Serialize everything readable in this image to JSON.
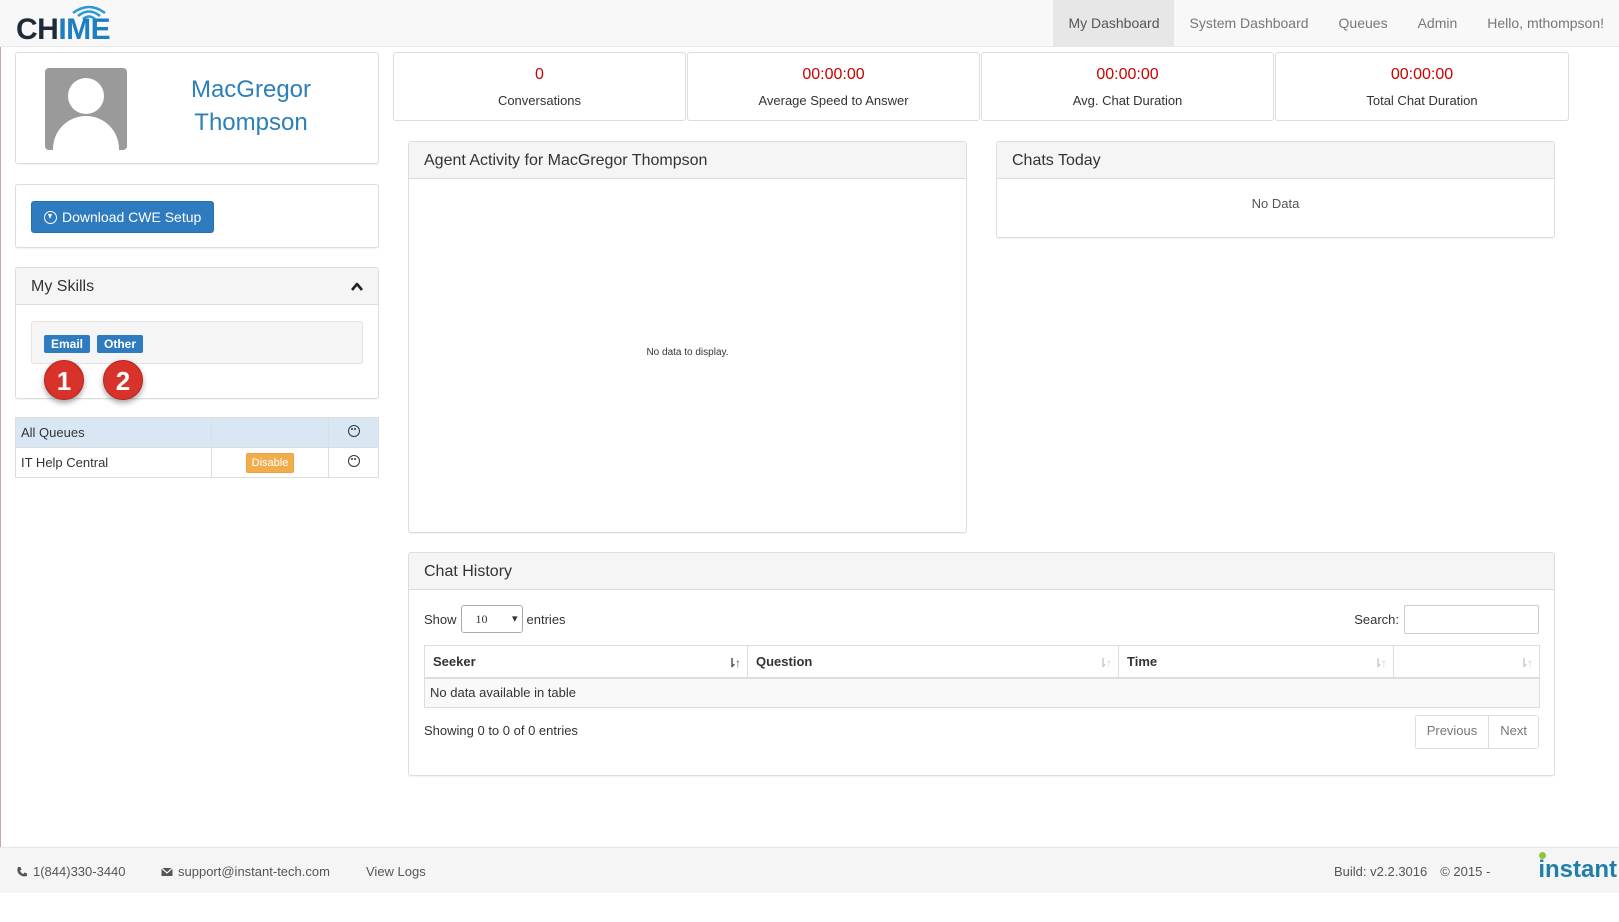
{
  "app": {
    "logo_text_left": "CH",
    "logo_text_right": "IME",
    "colors": {
      "primary": "#2e7bbf",
      "stat_value": "#cc0000",
      "warning": "#f0ad4e",
      "marker": "#d8322a",
      "brand": "#1f7fa8"
    }
  },
  "nav": {
    "items": [
      "My Dashboard",
      "System Dashboard",
      "Queues",
      "Admin",
      "Hello, mthompson!"
    ],
    "active": "My Dashboard"
  },
  "profile": {
    "first_name": "MacGregor",
    "last_name": "Thompson",
    "avatar_icon": "user-silhouette-icon"
  },
  "download": {
    "label": "Download CWE Setup",
    "icon": "download-circle-icon"
  },
  "skills": {
    "title": "My Skills",
    "tags": [
      "Email",
      "Other"
    ],
    "markers": [
      "1",
      "2"
    ]
  },
  "queues": {
    "rows": [
      {
        "name": "All Queues",
        "action": ""
      },
      {
        "name": "IT Help Central",
        "action": "Disable"
      }
    ]
  },
  "stats": [
    {
      "value": "0",
      "label": "Conversations"
    },
    {
      "value": "00:00:00",
      "label": "Average Speed to Answer"
    },
    {
      "value": "00:00:00",
      "label": "Avg. Chat Duration"
    },
    {
      "value": "00:00:00",
      "label": "Total Chat Duration"
    }
  ],
  "activity": {
    "title": "Agent Activity for MacGregor Thompson",
    "empty": "No data to display."
  },
  "chats_today": {
    "title": "Chats Today",
    "empty": "No Data"
  },
  "history": {
    "title": "Chat History",
    "show_label": "Show",
    "page_size": "10",
    "entries_label": "entries",
    "search_label": "Search:",
    "search_value": "",
    "columns": [
      "Seeker",
      "Question",
      "Time",
      ""
    ],
    "empty": "No data available in table",
    "info": "Showing 0 to 0 of 0 entries",
    "previous": "Previous",
    "next": "Next"
  },
  "footer": {
    "phone": "1(844)330-3440",
    "email": "support@instant-tech.com",
    "view_logs": "View Logs",
    "build": "Build: v2.2.3016",
    "copyright": "© 2015 -",
    "brand": "instant"
  }
}
